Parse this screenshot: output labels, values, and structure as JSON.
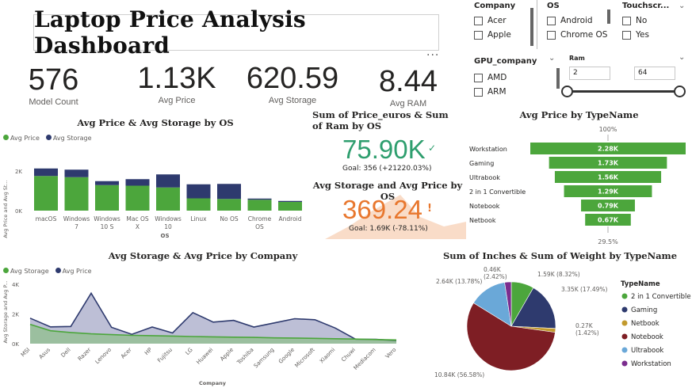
{
  "title": "Laptop Price Analysis Dashboard",
  "kpis": [
    {
      "value": "576",
      "label": "Model Count"
    },
    {
      "value": "1.13K",
      "label": "Avg Price"
    },
    {
      "value": "620.59",
      "label": "Avg Storage"
    },
    {
      "value": "8.44",
      "label": "Avg RAM"
    }
  ],
  "more_label": "···",
  "slicers": {
    "company": {
      "title": "Company",
      "options": [
        "Acer",
        "Apple"
      ]
    },
    "os": {
      "title": "OS",
      "options": [
        "Android",
        "Chrome OS"
      ]
    },
    "touch": {
      "title": "Touchscr...",
      "options": [
        "No",
        "Yes"
      ]
    },
    "gpu": {
      "title": "GPU_company",
      "options": [
        "AMD",
        "ARM"
      ]
    },
    "ram": {
      "title": "Ram",
      "min": "2",
      "max": "64"
    }
  },
  "colors": {
    "green": "#4ca63c",
    "navy": "#2e3a6e",
    "orange": "#e8772e",
    "orange_light": "#f6cdb0",
    "teal": "#2e9e6e"
  },
  "icons": {
    "dropdown": "chevron-down-icon",
    "checkbox": "checkbox-icon",
    "more": "more-options-icon"
  },
  "cards": {
    "price_ram": {
      "title": "Sum of Price_euros & Sum of Ram by OS",
      "value": "75.90K",
      "goal": "Goal: 356 (+21220.03%)",
      "mark": "✓"
    },
    "storage_price": {
      "title": "Avg Storage and Avg Price by OS",
      "value": "369.24",
      "goal": "Goal: 1.69K (-78.11%)",
      "mark": "!"
    }
  },
  "chart_data": [
    {
      "type": "bar",
      "title": "Avg Price & Avg Storage by OS",
      "xlabel": "OS",
      "ylabel": "Avg Price and Avg St...",
      "categories": [
        [
          "macOS"
        ],
        [
          "Windows",
          "7"
        ],
        [
          "Windows",
          "10 S"
        ],
        [
          "Mac OS",
          "X"
        ],
        [
          "Windows",
          "10"
        ],
        [
          "Linux"
        ],
        [
          "No OS"
        ],
        [
          "Chrome",
          "OS"
        ],
        [
          "Android"
        ]
      ],
      "yticks": [
        "0K",
        "2K"
      ],
      "ylim": [
        0,
        2500
      ],
      "series": [
        {
          "name": "Avg Price",
          "values": [
            1750,
            1690,
            1290,
            1260,
            1170,
            620,
            590,
            550,
            440
          ]
        },
        {
          "name": "Avg Storage",
          "values": [
            380,
            380,
            200,
            330,
            660,
            710,
            760,
            60,
            50
          ]
        }
      ]
    },
    {
      "type": "area",
      "title": "Avg Storage & Avg Price by Company",
      "xlabel": "Company",
      "ylabel": "Avg Storage and Avg P...",
      "categories": [
        "MSI",
        "Asus",
        "Dell",
        "Razer",
        "Lenovo",
        "Acer",
        "HP",
        "Fujitsu",
        "LG",
        "Huawei",
        "Apple",
        "Toshiba",
        "Samsung",
        "Google",
        "Microsoft",
        "Xiaomi",
        "Chuwi",
        "Mediacom",
        "Vero"
      ],
      "yticks": [
        "0K",
        "2K",
        "4K"
      ],
      "ylim": [
        0,
        4000
      ],
      "series": [
        {
          "name": "Avg Storage",
          "values": [
            1300,
            870,
            750,
            660,
            610,
            560,
            540,
            510,
            480,
            460,
            440,
            420,
            390,
            380,
            360,
            330,
            310,
            280,
            250
          ]
        },
        {
          "name": "Avg Price",
          "values": [
            1720,
            1130,
            1160,
            3400,
            1100,
            630,
            1120,
            720,
            2090,
            1450,
            1570,
            1120,
            1400,
            1680,
            1610,
            1050,
            300,
            290,
            200
          ]
        }
      ]
    },
    {
      "type": "bar",
      "title": "Avg Price by TypeName",
      "categories": [
        "Workstation",
        "Gaming",
        "Ultrabook",
        "2 in 1 Convertible",
        "Notebook",
        "Netbook"
      ],
      "values": [
        2280,
        1730,
        1560,
        1290,
        790,
        670
      ],
      "labels": [
        "2.28K",
        "1.73K",
        "1.56K",
        "1.29K",
        "0.79K",
        "0.67K"
      ],
      "top_label": "100%",
      "bottom_label": "29.5%"
    },
    {
      "type": "pie",
      "title": "Sum of Inches & Sum of Weight by TypeName",
      "legend_title": "TypeName",
      "slices": [
        {
          "name": "2 in 1 Convertible",
          "value": 1.59,
          "label": "1.59K (8.32%)",
          "percent": 8.32
        },
        {
          "name": "Gaming",
          "value": 3.35,
          "label": "3.35K (17.49%)",
          "percent": 17.49
        },
        {
          "name": "Netbook",
          "value": 0.27,
          "label_a": "0.27K",
          "label_b": "(1.42%)",
          "percent": 1.42
        },
        {
          "name": "Notebook",
          "value": 10.84,
          "label": "10.84K (56.58%)",
          "percent": 56.58
        },
        {
          "name": "Ultrabook",
          "value": 2.64,
          "label": "2.64K (13.78%)",
          "percent": 13.78
        },
        {
          "name": "Workstation",
          "value": 0.46,
          "label_a": "0.46K",
          "label_b": "(2.42%)",
          "percent": 2.42
        }
      ],
      "colors": [
        "#4ca63c",
        "#2e3a6e",
        "#c29a2e",
        "#7e1e24",
        "#6aa8d8",
        "#7b2d8e"
      ]
    }
  ]
}
